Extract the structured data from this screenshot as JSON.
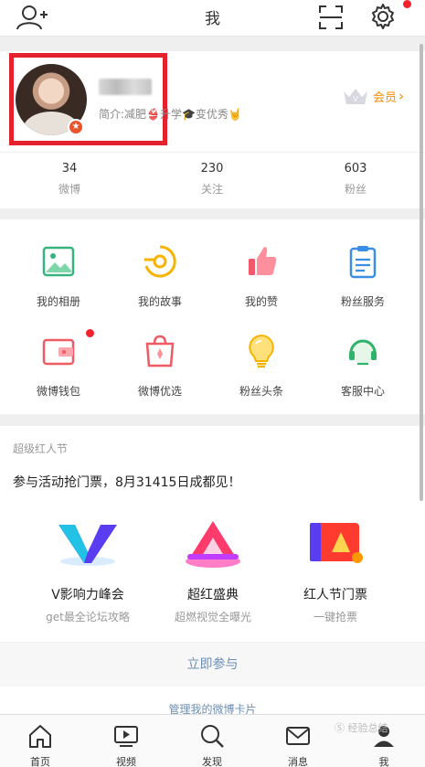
{
  "header": {
    "title": "我"
  },
  "profile": {
    "bio": "简介:减肥👙升学🎓变优秀🤘",
    "vip_label": "会员",
    "verify_badge": "★"
  },
  "stats": [
    {
      "count": "34",
      "label": "微博"
    },
    {
      "count": "230",
      "label": "关注"
    },
    {
      "count": "603",
      "label": "粉丝"
    }
  ],
  "grid": [
    {
      "label": "我的相册",
      "icon": "album-icon"
    },
    {
      "label": "我的故事",
      "icon": "story-icon"
    },
    {
      "label": "我的赞",
      "icon": "thumb-up-icon"
    },
    {
      "label": "粉丝服务",
      "icon": "clipboard-icon"
    },
    {
      "label": "微博钱包",
      "icon": "wallet-icon"
    },
    {
      "label": "微博优选",
      "icon": "shopping-bag-icon"
    },
    {
      "label": "粉丝头条",
      "icon": "lightbulb-icon"
    },
    {
      "label": "客服中心",
      "icon": "headset-icon"
    }
  ],
  "event": {
    "header": "超级红人节",
    "subtitle": "参与活动抢门票，8月31415日成都见！",
    "items": [
      {
        "title": "V影响力峰会",
        "subtitle": "get最全论坛攻略"
      },
      {
        "title": "超红盛典",
        "subtitle": "超燃视觉全曝光"
      },
      {
        "title": "红人节门票",
        "subtitle": "一键抢票"
      }
    ],
    "join_label": "立即参与",
    "peek_text": "管理我的微博卡片"
  },
  "tabs": [
    {
      "label": "首页",
      "icon": "home-icon"
    },
    {
      "label": "视频",
      "icon": "video-icon"
    },
    {
      "label": "发现",
      "icon": "search-icon"
    },
    {
      "label": "消息",
      "icon": "mail-icon"
    },
    {
      "label": "我",
      "icon": "profile-icon"
    }
  ],
  "watermark": "Ⓢ 经验总结"
}
